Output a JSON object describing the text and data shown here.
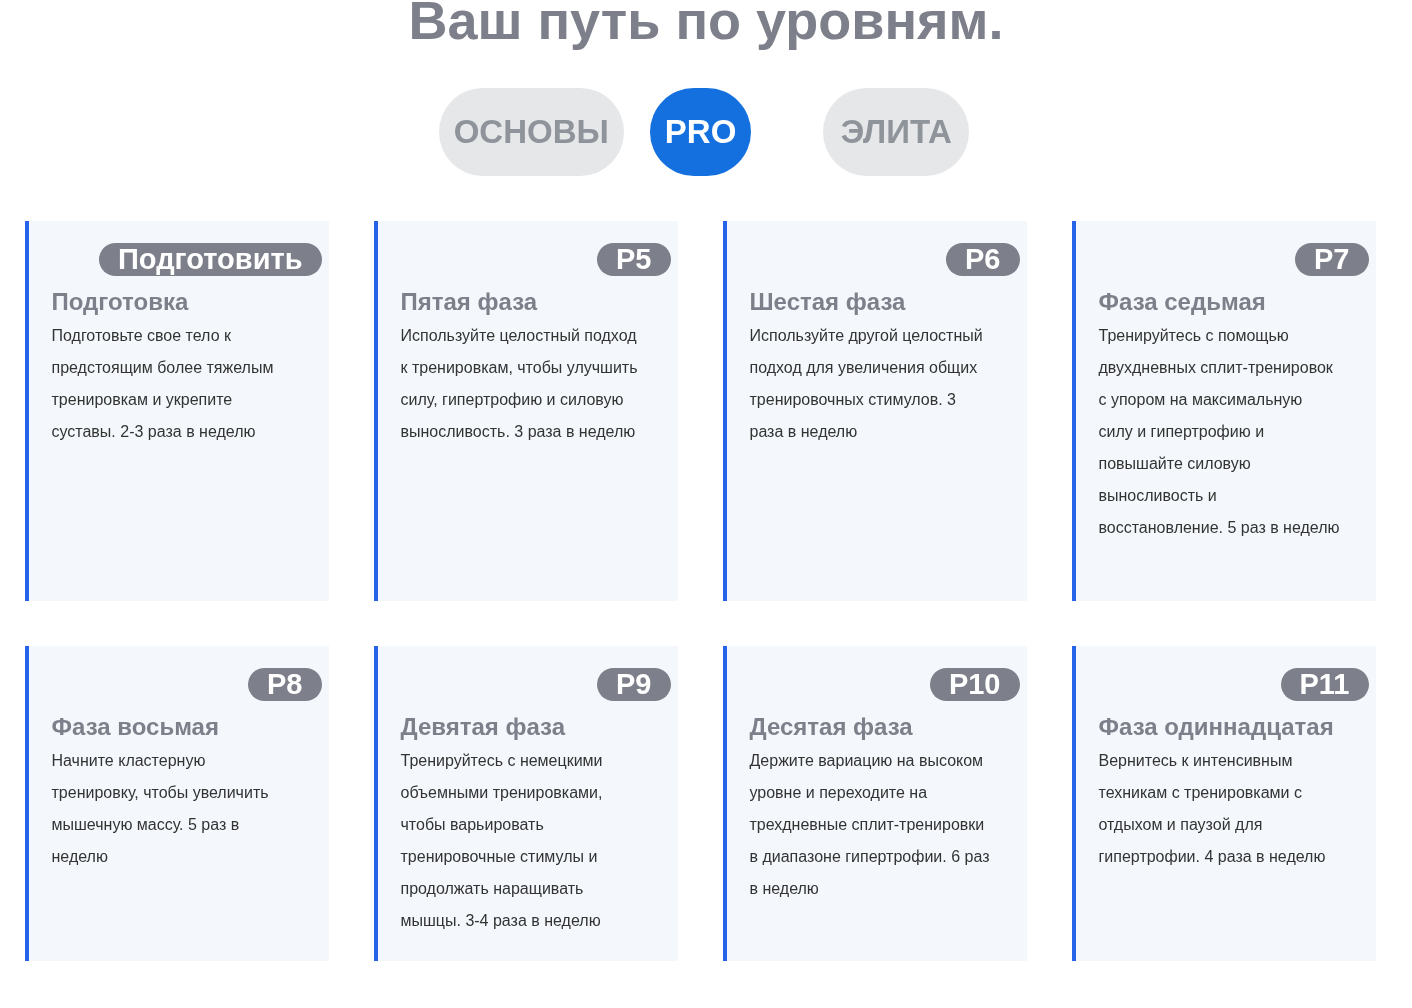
{
  "heading": "Ваш путь по уровням.",
  "tabs": [
    {
      "label": "ОСНОВЫ",
      "selected": false
    },
    {
      "label": "PRO",
      "selected": true
    },
    {
      "label": "ЭЛИТА",
      "selected": false
    }
  ],
  "phases": [
    {
      "badge": "Подготовить",
      "title": "Подготовка",
      "description": "Подготовьте свое тело к предстоящим более тяжелым тренировкам и укрепите суставы. 2-3 раза в неделю"
    },
    {
      "badge": "P5",
      "title": "Пятая фаза",
      "description": "Используйте целостный подход к тренировкам, чтобы улучшить силу, гипертрофию и силовую выносливость. 3 раза в неделю"
    },
    {
      "badge": "P6",
      "title": "Шестая фаза",
      "description": "Используйте другой целостный подход для увеличения общих тренировочных стимулов. 3 раза в неделю"
    },
    {
      "badge": "P7",
      "title": "Фаза седьмая",
      "description": "Тренируйтесь с помощью двухдневных сплит-тренировок с упором на максимальную силу и гипертрофию и повышайте силовую выносливость и восстановление. 5 раз в неделю"
    },
    {
      "badge": "P8",
      "title": "Фаза восьмая",
      "description": "Начните кластерную тренировку, чтобы увеличить мышечную массу. 5 раз в неделю"
    },
    {
      "badge": "P9",
      "title": "Девятая фаза",
      "description": "Тренируйтесь с немецкими объемными тренировками, чтобы варьировать тренировочные стимулы и продолжать наращивать мышцы. 3-4 раза в неделю"
    },
    {
      "badge": "P10",
      "title": "Десятая фаза",
      "description": "Держите вариацию на высоком уровне и переходите на трехдневные сплит-тренировки в диапазоне гипертрофии. 6 раз в неделю"
    },
    {
      "badge": "P11",
      "title": "Фаза одиннадцатая",
      "description": "Вернитесь к интенсивным техникам с тренировками с отдыхом и паузой для гипертрофии. 4 раза в неделю"
    }
  ]
}
